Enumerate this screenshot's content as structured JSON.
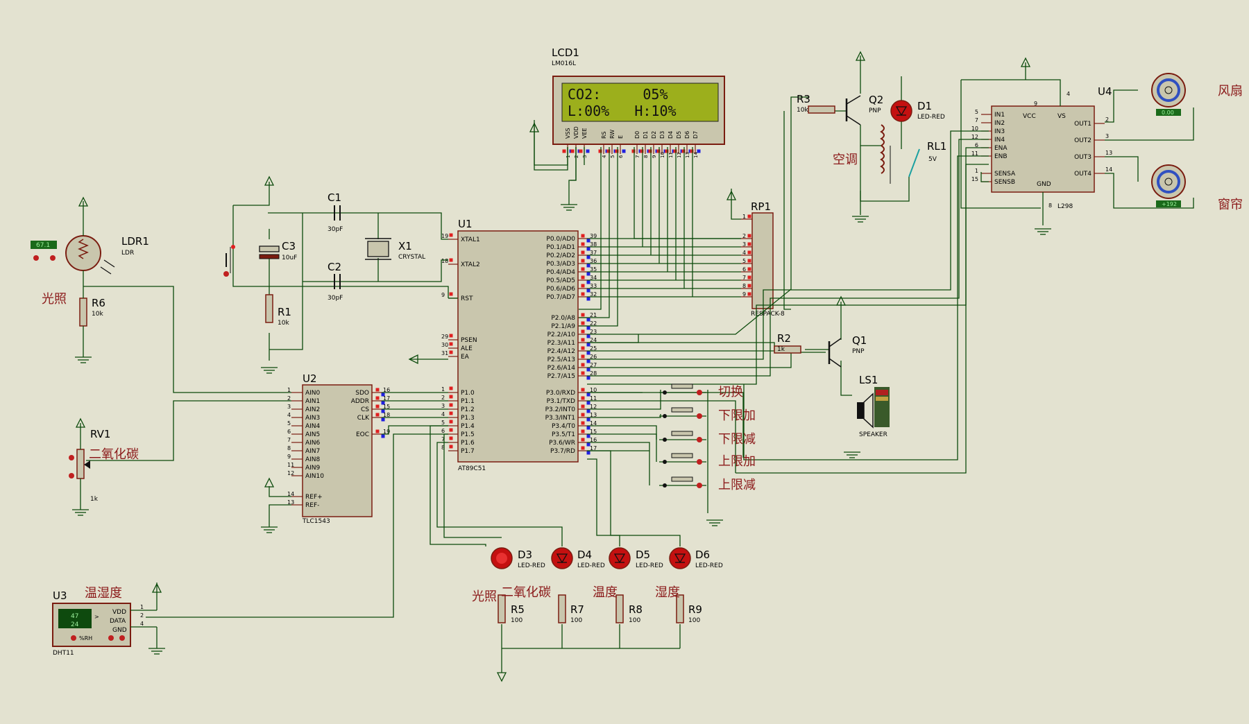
{
  "lcd": {
    "ref": "LCD1",
    "model": "LM016L",
    "line1": "CO2:     05%",
    "line2": "L:00%   H:10%",
    "pins": [
      "VSS",
      "VDD",
      "VEE",
      "RS",
      "RW",
      "E",
      "D0",
      "D1",
      "D2",
      "D3",
      "D4",
      "D5",
      "D6",
      "D7"
    ],
    "pin_nums": [
      "1",
      "2",
      "3",
      "4",
      "5",
      "6",
      "7",
      "8",
      "9",
      "10",
      "11",
      "12",
      "13",
      "14"
    ]
  },
  "mcu": {
    "ref": "U1",
    "model": "AT89C51",
    "left_pins": [
      {
        "n": "19",
        "l": "XTAL1"
      },
      {
        "n": "18",
        "l": "XTAL2"
      },
      {
        "n": "9",
        "l": "RST"
      },
      {
        "n": "29",
        "l": "PSEN"
      },
      {
        "n": "30",
        "l": "ALE"
      },
      {
        "n": "31",
        "l": "EA"
      },
      {
        "n": "1",
        "l": "P1.0"
      },
      {
        "n": "2",
        "l": "P1.1"
      },
      {
        "n": "3",
        "l": "P1.2"
      },
      {
        "n": "4",
        "l": "P1.3"
      },
      {
        "n": "5",
        "l": "P1.4"
      },
      {
        "n": "6",
        "l": "P1.5"
      },
      {
        "n": "7",
        "l": "P1.6"
      },
      {
        "n": "8",
        "l": "P1.7"
      }
    ],
    "right_pins": [
      {
        "n": "39",
        "l": "P0.0/AD0"
      },
      {
        "n": "38",
        "l": "P0.1/AD1"
      },
      {
        "n": "37",
        "l": "P0.2/AD2"
      },
      {
        "n": "36",
        "l": "P0.3/AD3"
      },
      {
        "n": "35",
        "l": "P0.4/AD4"
      },
      {
        "n": "34",
        "l": "P0.5/AD5"
      },
      {
        "n": "33",
        "l": "P0.6/AD6"
      },
      {
        "n": "32",
        "l": "P0.7/AD7"
      },
      {
        "n": "21",
        "l": "P2.0/A8"
      },
      {
        "n": "22",
        "l": "P2.1/A9"
      },
      {
        "n": "23",
        "l": "P2.2/A10"
      },
      {
        "n": "24",
        "l": "P2.3/A11"
      },
      {
        "n": "25",
        "l": "P2.4/A12"
      },
      {
        "n": "26",
        "l": "P2.5/A13"
      },
      {
        "n": "27",
        "l": "P2.6/A14"
      },
      {
        "n": "28",
        "l": "P2.7/A15"
      },
      {
        "n": "10",
        "l": "P3.0/RXD"
      },
      {
        "n": "11",
        "l": "P3.1/TXD"
      },
      {
        "n": "12",
        "l": "P3.2/INT0"
      },
      {
        "n": "13",
        "l": "P3.3/INT1"
      },
      {
        "n": "14",
        "l": "P3.4/T0"
      },
      {
        "n": "15",
        "l": "P3.5/T1"
      },
      {
        "n": "16",
        "l": "P3.6/WR"
      },
      {
        "n": "17",
        "l": "P3.7/RD"
      }
    ]
  },
  "adc": {
    "ref": "U2",
    "model": "TLC1543",
    "left_pins": [
      {
        "n": "1",
        "l": "AIN0"
      },
      {
        "n": "2",
        "l": "AIN1"
      },
      {
        "n": "3",
        "l": "AIN2"
      },
      {
        "n": "4",
        "l": "AIN3"
      },
      {
        "n": "5",
        "l": "AIN4"
      },
      {
        "n": "6",
        "l": "AIN5"
      },
      {
        "n": "7",
        "l": "AIN6"
      },
      {
        "n": "8",
        "l": "AIN7"
      },
      {
        "n": "9",
        "l": "AIN8"
      },
      {
        "n": "11",
        "l": "AIN9"
      },
      {
        "n": "12",
        "l": "AIN10"
      },
      {
        "n": "14",
        "l": "REF+"
      },
      {
        "n": "13",
        "l": "REF-"
      }
    ],
    "right_pins": [
      {
        "n": "16",
        "l": "SDO"
      },
      {
        "n": "17",
        "l": "ADDR"
      },
      {
        "n": "15",
        "l": "CS"
      },
      {
        "n": "18",
        "l": "CLK"
      },
      {
        "n": "19",
        "l": "EOC"
      }
    ]
  },
  "driver": {
    "ref": "U4",
    "model": "L298",
    "left_pins": [
      {
        "n": "5",
        "l": "IN1"
      },
      {
        "n": "7",
        "l": "IN2"
      },
      {
        "n": "10",
        "l": "IN3"
      },
      {
        "n": "12",
        "l": "IN4"
      },
      {
        "n": "6",
        "l": "ENA"
      },
      {
        "n": "11",
        "l": "ENB"
      },
      {
        "n": "1",
        "l": "SENSA"
      },
      {
        "n": "15",
        "l": "SENSB"
      }
    ],
    "right_pins": [
      {
        "n": "2",
        "l": "OUT1"
      },
      {
        "n": "3",
        "l": "OUT2"
      },
      {
        "n": "13",
        "l": "OUT3"
      },
      {
        "n": "14",
        "l": "OUT4"
      }
    ],
    "top": [
      {
        "n": "9",
        "l": "VCC"
      },
      {
        "n": "4",
        "l": "VS"
      }
    ],
    "bottom": {
      "n": "8",
      "l": "GND"
    }
  },
  "respack": {
    "ref": "RP1",
    "model": "RESPACK-8",
    "pins": [
      "1",
      "2",
      "3",
      "4",
      "5",
      "6",
      "7",
      "8",
      "9"
    ]
  },
  "crystal": {
    "ref": "X1",
    "model": "CRYSTAL"
  },
  "caps": [
    {
      "ref": "C1",
      "val": "30pF"
    },
    {
      "ref": "C2",
      "val": "30pF"
    },
    {
      "ref": "C3",
      "val": "10uF"
    }
  ],
  "resistors": [
    {
      "ref": "R1",
      "val": "10k"
    },
    {
      "ref": "R2",
      "val": "1k"
    },
    {
      "ref": "R3",
      "val": "10k"
    },
    {
      "ref": "R5",
      "val": "100"
    },
    {
      "ref": "R6",
      "val": "10k"
    },
    {
      "ref": "R7",
      "val": "100"
    },
    {
      "ref": "R8",
      "val": "100"
    },
    {
      "ref": "R9",
      "val": "100"
    }
  ],
  "transistors": [
    {
      "ref": "Q1",
      "type": "PNP"
    },
    {
      "ref": "Q2",
      "type": "PNP"
    }
  ],
  "relay": {
    "ref": "RL1",
    "val": "5V"
  },
  "speaker": {
    "ref": "LS1",
    "model": "SPEAKER"
  },
  "ldr": {
    "ref": "LDR1",
    "model": "LDR",
    "reading": "67.1"
  },
  "pot": {
    "ref": "RV1",
    "val": "1k"
  },
  "dht": {
    "ref": "U3",
    "model": "DHT11",
    "temp": "47",
    "hum": "24",
    "unit": "%RH",
    "pins": [
      {
        "n": "1",
        "l": "VDD"
      },
      {
        "n": "2",
        "l": "DATA"
      },
      {
        "n": "4",
        "l": "GND"
      }
    ]
  },
  "leds": [
    {
      "ref": "D1",
      "model": "LED-RED"
    },
    {
      "ref": "D3",
      "model": "LED-RED"
    },
    {
      "ref": "D4",
      "model": "LED-RED"
    },
    {
      "ref": "D5",
      "model": "LED-RED"
    },
    {
      "ref": "D6",
      "model": "LED-RED"
    }
  ],
  "motors": [
    {
      "reading": "0.00"
    },
    {
      "reading": "+192"
    }
  ],
  "labels": {
    "light": "光照",
    "co2": "二氧化碳",
    "temp": "温度",
    "hum": "湿度",
    "tempHum": "温湿度",
    "ac": "空调",
    "fan": "风扇",
    "curtain": "窗帘",
    "sw1": "切换",
    "sw2": "下限加",
    "sw3": "下限减",
    "sw4": "上限加",
    "sw5": "上限减"
  },
  "colors": {
    "wire": "#0b4a0b",
    "body": "#c9c6ad",
    "outline": "#7a1c10",
    "lcdGlass": "#9caf1c",
    "led": "#c41010",
    "label": "#8b1a1a"
  }
}
